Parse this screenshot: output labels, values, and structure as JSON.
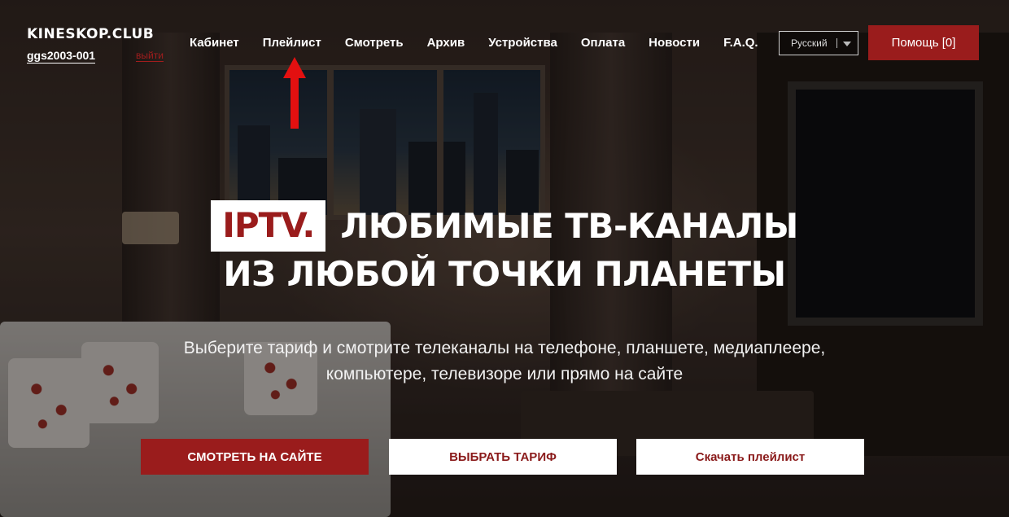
{
  "header": {
    "brand": "KINESKOP.CLUB",
    "user_id": "ggs2003-001",
    "logout_label": "выйти",
    "nav": [
      {
        "label": "Кабинет"
      },
      {
        "label": "Плейлист"
      },
      {
        "label": "Смотреть"
      },
      {
        "label": "Архив"
      },
      {
        "label": "Устройства"
      },
      {
        "label": "Оплата"
      },
      {
        "label": "Новости"
      },
      {
        "label": "F.A.Q."
      }
    ],
    "language_selected": "Русский",
    "help_label": "Помощь [0]"
  },
  "hero": {
    "badge": "IPTV.",
    "line1": "ЛЮБИМЫЕ ТВ-КАНАЛЫ",
    "line2": "ИЗ ЛЮБОЙ ТОЧКИ ПЛАНЕТЫ",
    "subtitle_line1": "Выберите тариф и смотрите телеканалы на телефоне, планшете, медиаплеере,",
    "subtitle_line2": "компьютере, телевизоре или прямо на сайте"
  },
  "actions": {
    "watch_label": "СМОТРЕТЬ НА САЙТЕ",
    "tariff_label": "ВЫБРАТЬ ТАРИФ",
    "download_label": "Скачать плейлист"
  },
  "annotation": {
    "arrow_icon": "up-arrow-icon",
    "arrow_color": "#e31010"
  },
  "colors": {
    "accent": "#9a1c1c",
    "text": "#ffffff"
  }
}
